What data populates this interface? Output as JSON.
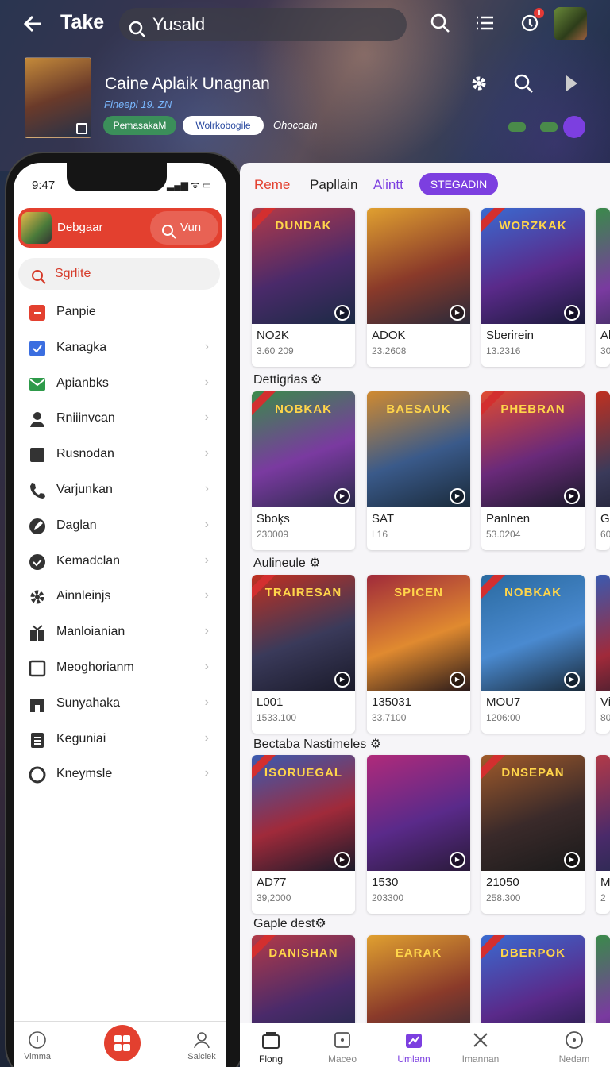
{
  "app": {
    "title": "Take",
    "search_value": "Yusald",
    "notif_count": "II"
  },
  "game": {
    "title": "Caine Aplaik Unagnan",
    "subtitle": "Fineepi 19. ZN",
    "tag1": "PemasakaM",
    "tag2": "Wolrkobogile",
    "tag3": "Ohocoain"
  },
  "phone": {
    "time": "9:47",
    "header_label": "Debgaar",
    "header_button": "Vun",
    "search_placeholder": "Sgrlite",
    "menu": [
      {
        "label": "Panpie",
        "icon": "red-square-icon"
      },
      {
        "label": "Kanagka",
        "icon": "blue-check-icon"
      },
      {
        "label": "Apianbks",
        "icon": "mail-icon"
      },
      {
        "label": "Rniiinvcan",
        "icon": "person-icon"
      },
      {
        "label": "Rusnodan",
        "icon": "square-icon"
      },
      {
        "label": "Varjunkan",
        "icon": "phone-icon"
      },
      {
        "label": "Daglan",
        "icon": "edit-icon"
      },
      {
        "label": "Kemadclan",
        "icon": "check-circle-icon"
      },
      {
        "label": "Ainnleinjs",
        "icon": "gear-icon"
      },
      {
        "label": "Manloianian",
        "icon": "gift-icon"
      },
      {
        "label": "Meoghorianm",
        "icon": "square-outline-icon"
      },
      {
        "label": "Sunyahaka",
        "icon": "store-icon"
      },
      {
        "label": "Keguniai",
        "icon": "clipboard-icon"
      },
      {
        "label": "Kneymsle",
        "icon": "circle-icon"
      }
    ],
    "nav": {
      "left": "Vimma",
      "right": "Saiclek"
    }
  },
  "tabs": [
    "Reme",
    "Papllain",
    "Alintt",
    "STEGADIN"
  ],
  "sections": [
    "Dettigrias ⚙",
    "Aulineule ⚙",
    "Bectaba Nastimeles ⚙",
    "Gaple dest⚙"
  ],
  "rows": [
    [
      {
        "title": "NO2K",
        "sub": "3.60 209",
        "art": "DUNDAK"
      },
      {
        "title": "ADOK",
        "sub": "23.2608",
        "art": ""
      },
      {
        "title": "Sberirein",
        "sub": "13.2316",
        "art": "WORZKAK"
      },
      {
        "title": "Al",
        "sub": "30",
        "art": ""
      }
    ],
    [
      {
        "title": "Sboķs",
        "sub": "230009",
        "art": "NOBKAK"
      },
      {
        "title": "SAT",
        "sub": "L16",
        "art": "BAESAUK"
      },
      {
        "title": "Panlnen",
        "sub": "53.0204",
        "art": "PHEBRAN"
      },
      {
        "title": "Gl",
        "sub": "60",
        "art": ""
      }
    ],
    [
      {
        "title": "L001",
        "sub": "1533.100",
        "art": "TRAIRESAN"
      },
      {
        "title": "135031",
        "sub": "33.7100",
        "art": "SPICEN"
      },
      {
        "title": "MOU7",
        "sub": "1206:00",
        "art": "NOBKAK"
      },
      {
        "title": "Vi",
        "sub": "80",
        "art": ""
      }
    ],
    [
      {
        "title": "AD77",
        "sub": "39,2000",
        "art": "ISORUEGAL"
      },
      {
        "title": "1530",
        "sub": "203300",
        "art": ""
      },
      {
        "title": "21050",
        "sub": "258.300",
        "art": "DNSEPAN"
      },
      {
        "title": "M",
        "sub": "2",
        "art": ""
      }
    ],
    [
      {
        "title": "",
        "sub": "",
        "art": "DANISHAN"
      },
      {
        "title": "",
        "sub": "",
        "art": "EARAK"
      },
      {
        "title": "",
        "sub": "",
        "art": "DBERPOK"
      },
      {
        "title": "",
        "sub": "",
        "art": ""
      }
    ]
  ],
  "bottom_nav": [
    {
      "label": "Flong",
      "active": false
    },
    {
      "label": "Maceo",
      "active": false
    },
    {
      "label": "Umlann",
      "active": true
    },
    {
      "label": "Imannan",
      "active": false
    },
    {
      "label": "Nedam",
      "active": false
    }
  ],
  "colors": {
    "accent": "#7c3fe0",
    "brand_red": "#e3402f"
  }
}
